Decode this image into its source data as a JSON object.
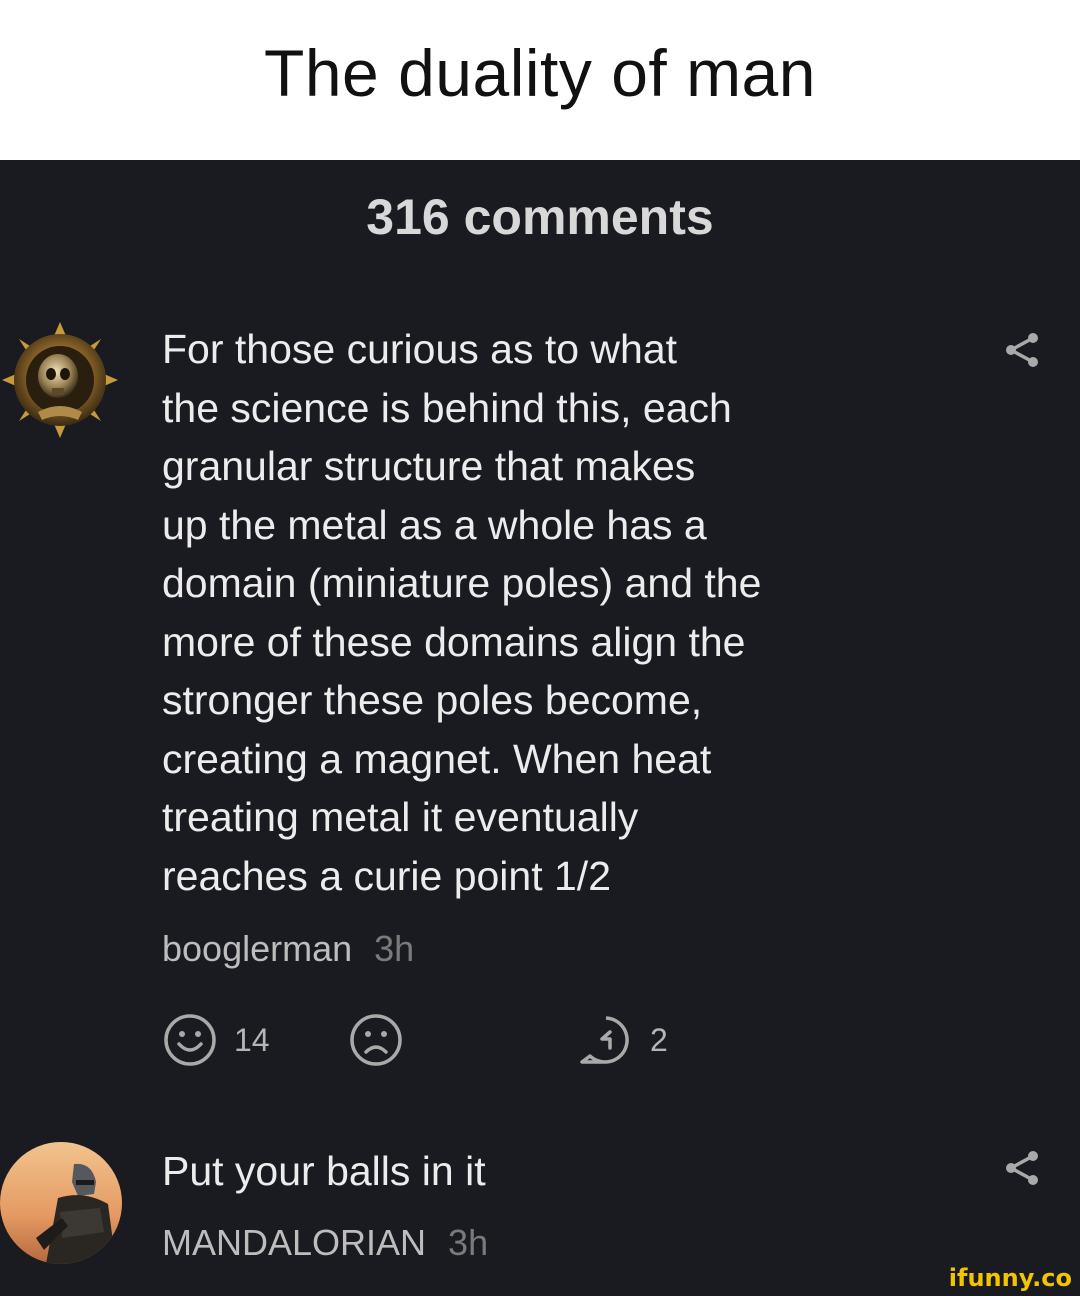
{
  "caption": "The duality of man",
  "comments_header": "316 comments",
  "comments": [
    {
      "text": "For those curious as to what\nthe science is behind this, each\ngranular structure that makes\nup the metal as a whole has a\ndomain (miniature poles) and the\nmore of these domains align the\nstronger these poles become,\ncreating a magnet. When heat\ntreating metal it eventually\nreaches a curie point 1/2",
      "author": "booglerman",
      "time": "3h",
      "smile_count": "14",
      "reply_count": "2"
    },
    {
      "text": "Put your balls in it",
      "author": "MANDALORIAN",
      "time": "3h"
    }
  ],
  "watermark": "ifunny.co",
  "colors": {
    "background": "#1a1b20",
    "caption_bg": "#ffffff",
    "icon_gray": "#a9a9a9",
    "watermark": "#f2c500"
  }
}
